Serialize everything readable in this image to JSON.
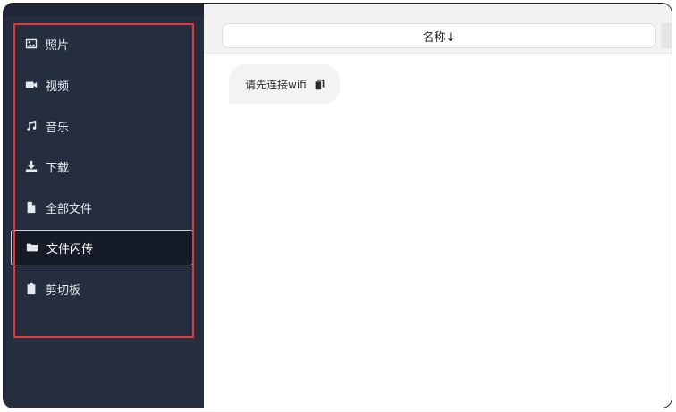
{
  "sidebar": {
    "items": [
      {
        "label": "照片",
        "icon": "image-icon"
      },
      {
        "label": "视频",
        "icon": "video-camera-icon"
      },
      {
        "label": "音乐",
        "icon": "music-note-icon"
      },
      {
        "label": "下载",
        "icon": "download-icon"
      },
      {
        "label": "全部文件",
        "icon": "file-icon"
      },
      {
        "label": "文件闪传",
        "icon": "folder-icon",
        "active": true
      },
      {
        "label": "剪切板",
        "icon": "clipboard-icon"
      }
    ]
  },
  "main": {
    "sort_label": "名称↓",
    "wifi_message": "请先连接wifi"
  },
  "colors": {
    "sidebar_bg": "#252e3f",
    "active_bg": "#161b28",
    "highlight_border": "#e03a3f"
  }
}
